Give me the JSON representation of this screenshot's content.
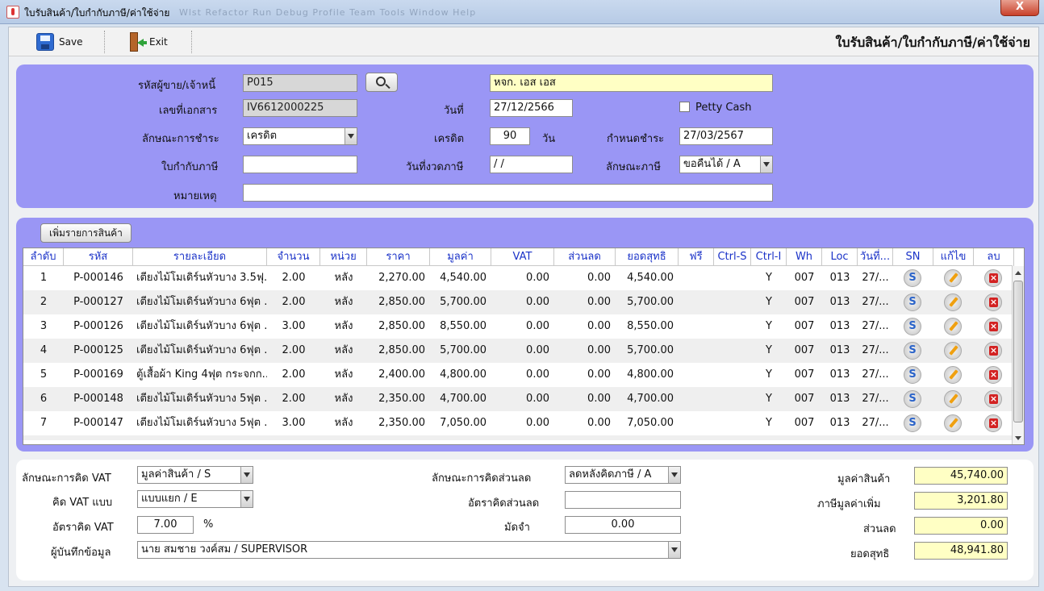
{
  "window": {
    "title": "ใบรับสินค้า/ใบกำกับภาษี/ค่าใช้จ่าย",
    "ghost_menu": "Wlst  Refactor  Run  Debug  Profile  Team  Tools  Window  Help",
    "close_label": "X"
  },
  "toolbar": {
    "save_label": "Save",
    "exit_label": "Exit",
    "page_title": "ใบรับสินค้า/ใบกำกับภาษี/ค่าใช้จ่าย"
  },
  "header": {
    "vendor_code_label": "รหัสผู้ขาย/เจ้าหนี้",
    "vendor_code": "P015",
    "vendor_name": "หจก. เอส เอส",
    "doc_no_label": "เลขที่เอกสาร",
    "doc_no": "IV6612000225",
    "date_label": "วันที่",
    "date": "27/12/2566",
    "petty_cash_label": "Petty Cash",
    "payment_type_label": "ลักษณะการชำระ",
    "payment_type": "เครดิต",
    "credit_label": "เครดิต",
    "credit_days": "90",
    "days_unit": "วัน",
    "due_label": "กำหนดชำระ",
    "due_date": "27/03/2567",
    "tax_invoice_label": "ใบกำกับภาษี",
    "tax_invoice": "",
    "tax_period_label": "วันที่งวดภาษี",
    "tax_period": " /  /",
    "tax_type_label": "ลักษณะภาษี",
    "tax_type": "ขอคืนได้ / A",
    "remark_label": "หมายเหตุ",
    "remark": ""
  },
  "grid": {
    "add_button": "เพิ่มรายการสินค้า",
    "columns": [
      "ลำดับ",
      "รหัส",
      "รายละเอียด",
      "จำนวน",
      "หน่วย",
      "ราคา",
      "มูลค่า",
      "VAT",
      "ส่วนลด",
      "ยอดสุทธิ",
      "ฟรี",
      "Ctrl-S",
      "Ctrl-I",
      "Wh",
      "Loc",
      "วันที่...",
      "SN",
      "แก้ไข",
      "ลบ"
    ],
    "rows": [
      [
        "1",
        "P-000146",
        "เตียงไม้โมเดิร์นหัวบาง 3.5ฟุ.",
        "2.00",
        "หลัง",
        "2,270.00",
        "4,540.00",
        "0.00",
        "0.00",
        "4,540.00",
        "",
        "",
        "Y",
        "007",
        "013",
        "27/..."
      ],
      [
        "2",
        "P-000127",
        "เตียงไม้โมเดิร์นหัวบาง 6ฟุต .",
        "2.00",
        "หลัง",
        "2,850.00",
        "5,700.00",
        "0.00",
        "0.00",
        "5,700.00",
        "",
        "",
        "Y",
        "007",
        "013",
        "27/..."
      ],
      [
        "3",
        "P-000126",
        "เตียงไม้โมเดิร์นหัวบาง 6ฟุต .",
        "3.00",
        "หลัง",
        "2,850.00",
        "8,550.00",
        "0.00",
        "0.00",
        "8,550.00",
        "",
        "",
        "Y",
        "007",
        "013",
        "27/..."
      ],
      [
        "4",
        "P-000125",
        "เตียงไม้โมเดิร์นหัวบาง 6ฟุต .",
        "2.00",
        "หลัง",
        "2,850.00",
        "5,700.00",
        "0.00",
        "0.00",
        "5,700.00",
        "",
        "",
        "Y",
        "007",
        "013",
        "27/..."
      ],
      [
        "5",
        "P-000169",
        "ตู้เสื้อผ้า King 4ฟุต กระจกก..",
        "2.00",
        "หลัง",
        "2,400.00",
        "4,800.00",
        "0.00",
        "0.00",
        "4,800.00",
        "",
        "",
        "Y",
        "007",
        "013",
        "27/..."
      ],
      [
        "6",
        "P-000148",
        "เตียงไม้โมเดิร์นหัวบาง 5ฟุต .",
        "2.00",
        "หลัง",
        "2,350.00",
        "4,700.00",
        "0.00",
        "0.00",
        "4,700.00",
        "",
        "",
        "Y",
        "007",
        "013",
        "27/..."
      ],
      [
        "7",
        "P-000147",
        "เตียงไม้โมเดิร์นหัวบาง 5ฟุต .",
        "3.00",
        "หลัง",
        "2,350.00",
        "7,050.00",
        "0.00",
        "0.00",
        "7,050.00",
        "",
        "",
        "Y",
        "007",
        "013",
        "27/..."
      ]
    ]
  },
  "footer": {
    "vat_calc_label": "ลักษณะการคิด VAT",
    "vat_calc": "มูลค่าสินค้า / S",
    "vat_mode_label": "คิด VAT แบบ",
    "vat_mode": "แบบแยก / E",
    "vat_rate_label": "อัตราคิด VAT",
    "vat_rate": "7.00",
    "percent": "%",
    "recorder_label": "ผู้บันทึกข้อมูล",
    "recorder": "นาย สมชาย วงค์สม / SUPERVISOR",
    "discount_calc_label": "ลักษณะการคิดส่วนลด",
    "discount_calc": "ลดหลังคิดภาษี / A",
    "discount_rate_label": "อัตราคิดส่วนลด",
    "discount_rate": "",
    "deposit_label": "มัดจำ",
    "deposit": "0.00",
    "goods_value_label": "มูลค่าสินค้า",
    "goods_value": "45,740.00",
    "vat_amount_label": "ภาษีมูลค่าเพิ่ม",
    "vat_amount": "3,201.80",
    "discount_label": "ส่วนลด",
    "discount": "0.00",
    "net_label": "ยอดสุทธิ",
    "net": "48,941.80"
  }
}
